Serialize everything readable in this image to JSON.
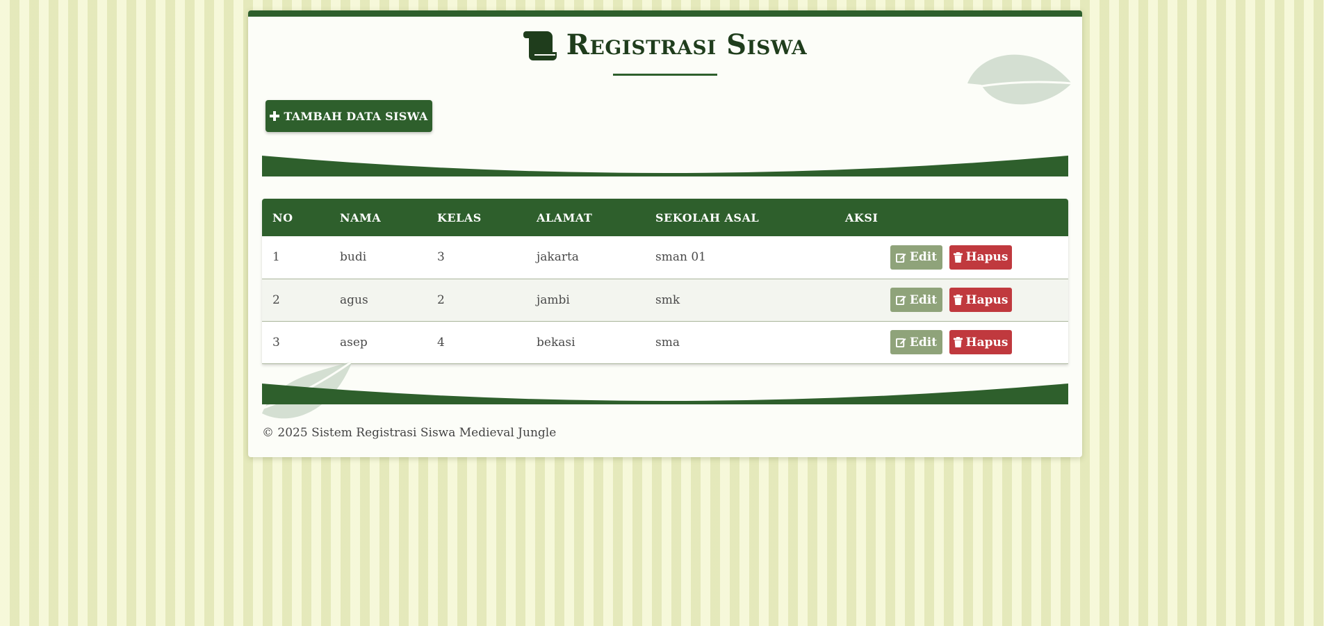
{
  "page": {
    "title": "Registrasi Siswa",
    "title_icon": "scroll-icon",
    "add_button_label": "TAMBAH DATA SISWA",
    "add_button_icon": "plus-icon",
    "footer": "© 2025 Sistem Registrasi Siswa Medieval Jungle"
  },
  "colors": {
    "primary": "#2e5f2c",
    "edit": "#8fa37a",
    "delete": "#c0393e",
    "background": "#ecf0c4"
  },
  "table": {
    "headers": [
      "NO",
      "NAMA",
      "KELAS",
      "ALAMAT",
      "SEKOLAH ASAL",
      "AKSI"
    ],
    "edit_label": "Edit",
    "delete_label": "Hapus",
    "rows": [
      {
        "no": "1",
        "nama": "budi",
        "kelas": "3",
        "alamat": "jakarta",
        "sekolah": "sman 01"
      },
      {
        "no": "2",
        "nama": "agus",
        "kelas": "2",
        "alamat": "jambi",
        "sekolah": "smk"
      },
      {
        "no": "3",
        "nama": "asep",
        "kelas": "4",
        "alamat": "bekasi",
        "sekolah": "sma"
      }
    ]
  }
}
